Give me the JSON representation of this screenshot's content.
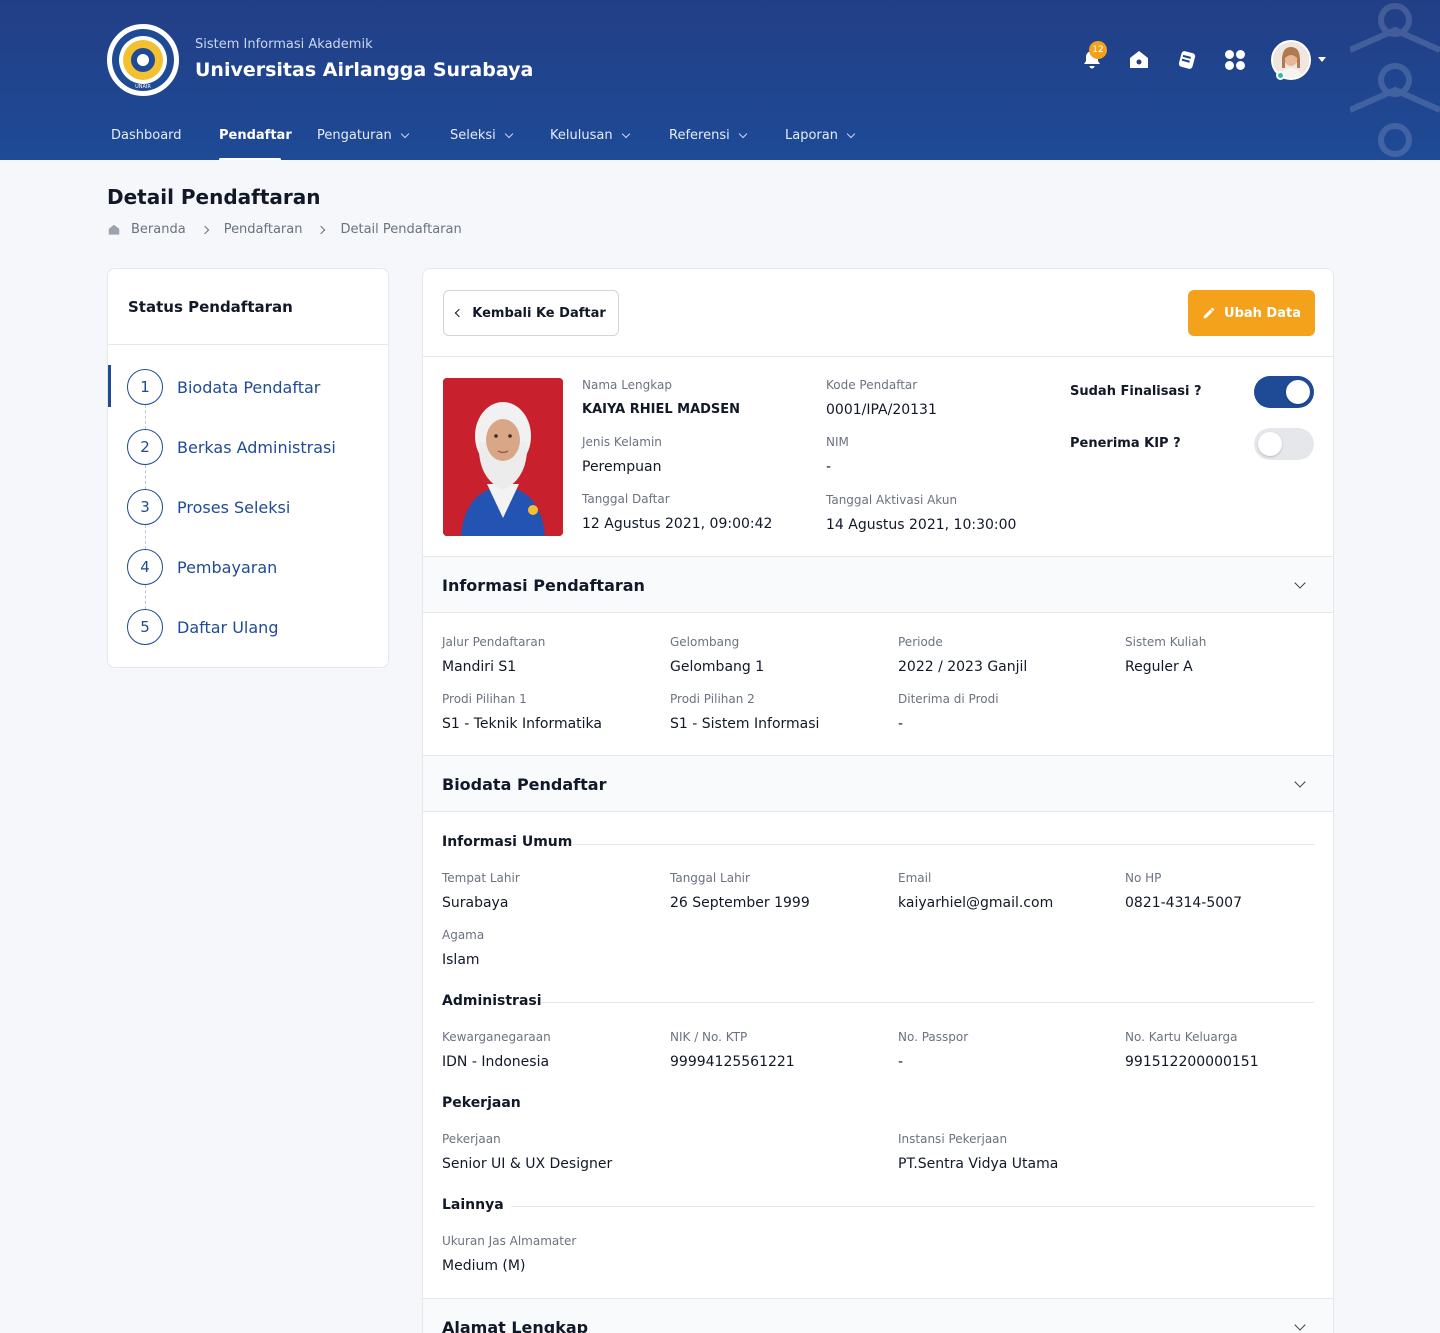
{
  "header": {
    "subtitle": "Sistem Informasi Akademik",
    "title": "Universitas Airlangga Surabaya",
    "notification_count": "12",
    "logo_text": "UNAIR"
  },
  "nav": {
    "items": [
      {
        "label": "Dashboard",
        "active": false,
        "has_dropdown": false
      },
      {
        "label": "Pendaftar",
        "active": true,
        "has_dropdown": false
      },
      {
        "label": "Pengaturan",
        "active": false,
        "has_dropdown": true
      },
      {
        "label": "Seleksi",
        "active": false,
        "has_dropdown": true
      },
      {
        "label": "Kelulusan",
        "active": false,
        "has_dropdown": true
      },
      {
        "label": "Referensi",
        "active": false,
        "has_dropdown": true
      },
      {
        "label": "Laporan",
        "active": false,
        "has_dropdown": true
      }
    ]
  },
  "page": {
    "title": "Detail Pendaftaran",
    "breadcrumb": [
      "Beranda",
      "Pendaftaran",
      "Detail Pendaftaran"
    ]
  },
  "status": {
    "title": "Status Pendaftaran",
    "steps": [
      {
        "num": "1",
        "label": "Biodata Pendaftar"
      },
      {
        "num": "2",
        "label": "Berkas Administrasi"
      },
      {
        "num": "3",
        "label": "Proses Seleksi"
      },
      {
        "num": "4",
        "label": "Pembayaran"
      },
      {
        "num": "5",
        "label": "Daftar Ulang"
      }
    ]
  },
  "actions": {
    "back_label": "Kembali Ke Daftar",
    "edit_label": "Ubah Data"
  },
  "profile": {
    "name_label": "Nama Lengkap",
    "name": "KAIYA RHIEL MADSEN",
    "code_label": "Kode Pendaftar",
    "code": "0001/IPA/20131",
    "gender_label": "Jenis Kelamin",
    "gender": "Perempuan",
    "nim_label": "NIM",
    "nim": "-",
    "reg_date_label": "Tanggal Daftar",
    "reg_date": "12 Agustus 2021, 09:00:42",
    "activation_label": "Tanggal Aktivasi Akun",
    "activation": "14 Agustus 2021, 10:30:00",
    "finalized_label": "Sudah Finalisasi ?",
    "finalized": true,
    "kip_label": "Penerima KIP ?",
    "kip": false
  },
  "info_pendaftaran": {
    "title": "Informasi Pendaftaran",
    "fields": [
      {
        "label": "Jalur Pendaftaran",
        "value": "Mandiri S1"
      },
      {
        "label": "Gelombang",
        "value": "Gelombang 1"
      },
      {
        "label": "Periode",
        "value": "2022 / 2023 Ganjil"
      },
      {
        "label": "Sistem Kuliah",
        "value": "Reguler A"
      },
      {
        "label": "Prodi Pilihan 1",
        "value": "S1 - Teknik Informatika"
      },
      {
        "label": "Prodi Pilihan 2",
        "value": "S1 - Sistem Informasi"
      },
      {
        "label": "Diterima di Prodi",
        "value": "-"
      }
    ]
  },
  "biodata": {
    "title": "Biodata Pendaftar",
    "umum_title": "Informasi Umum",
    "umum": [
      {
        "label": "Tempat Lahir",
        "value": "Surabaya"
      },
      {
        "label": "Tanggal Lahir",
        "value": "26 September 1999"
      },
      {
        "label": "Email",
        "value": "kaiyarhiel@gmail.com"
      },
      {
        "label": "No HP",
        "value": "0821-4314-5007"
      },
      {
        "label": "Agama",
        "value": "Islam"
      }
    ],
    "admin_title": "Administrasi",
    "admin": [
      {
        "label": "Kewarganegaraan",
        "value": "IDN - Indonesia"
      },
      {
        "label": "NIK / No. KTP",
        "value": "99994125561221"
      },
      {
        "label": "No. Passpor",
        "value": "-"
      },
      {
        "label": "No. Kartu Keluarga",
        "value": "991512200000151"
      }
    ],
    "job_title": "Pekerjaan",
    "job": [
      {
        "label": "Pekerjaan",
        "value": "Senior UI & UX Designer"
      },
      {
        "label": "Instansi Pekerjaan",
        "value": "PT.Sentra Vidya Utama"
      }
    ],
    "other_title": "Lainnya",
    "other": [
      {
        "label": "Ukuran Jas Almamater",
        "value": "Medium (M)"
      }
    ]
  },
  "alamat": {
    "title": "Alamat Lengkap"
  },
  "colors": {
    "primary": "#1f4a96",
    "accent": "#f4a11c",
    "header_bg": "#223f86"
  }
}
